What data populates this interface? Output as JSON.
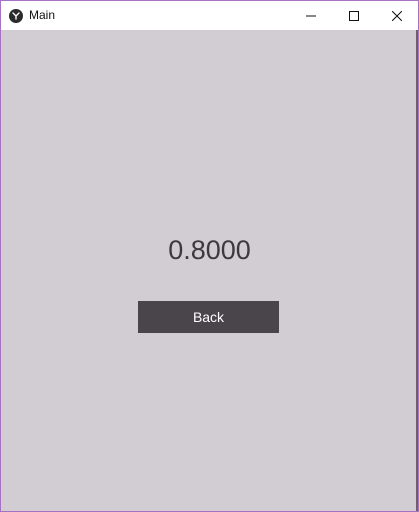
{
  "window": {
    "title": "Main",
    "app_icon": "kivy-logo-icon",
    "controls": {
      "minimize_icon": "minimize-icon",
      "maximize_icon": "maximize-icon",
      "close_icon": "close-icon"
    }
  },
  "main": {
    "value": "0.8000",
    "back_label": "Back"
  },
  "colors": {
    "background": "#d2cdd2",
    "button": "#4a454a",
    "text": "#3e393e",
    "window_border": "#a872c4"
  }
}
